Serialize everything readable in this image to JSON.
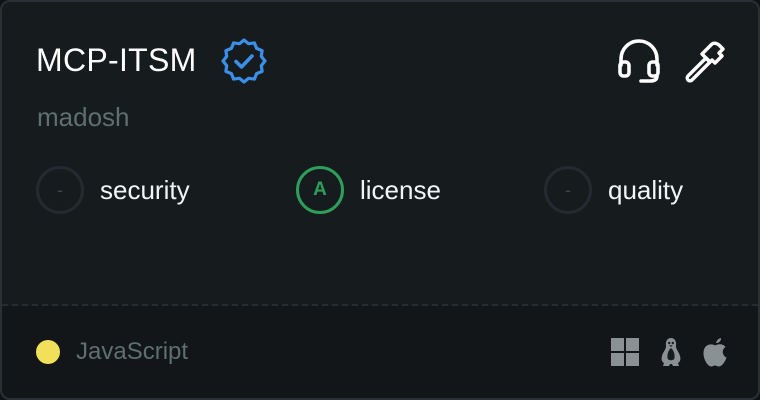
{
  "server": {
    "name": "MCP-ITSM",
    "author": "madosh",
    "verified_icon": "verified-badge-icon",
    "header_icons": [
      "headset-icon",
      "hammer-icon"
    ]
  },
  "scores": [
    {
      "grade": "-",
      "label": "security"
    },
    {
      "grade": "A",
      "label": "license"
    },
    {
      "grade": "-",
      "label": "quality"
    }
  ],
  "footer": {
    "language": "JavaScript",
    "language_color": "#f1e05a",
    "platforms": [
      "windows-icon",
      "linux-icon",
      "apple-icon"
    ]
  },
  "colors": {
    "verified": "#3b8fe8",
    "grade_a": "#2e9f5a",
    "card_bg": "#161b1e"
  }
}
